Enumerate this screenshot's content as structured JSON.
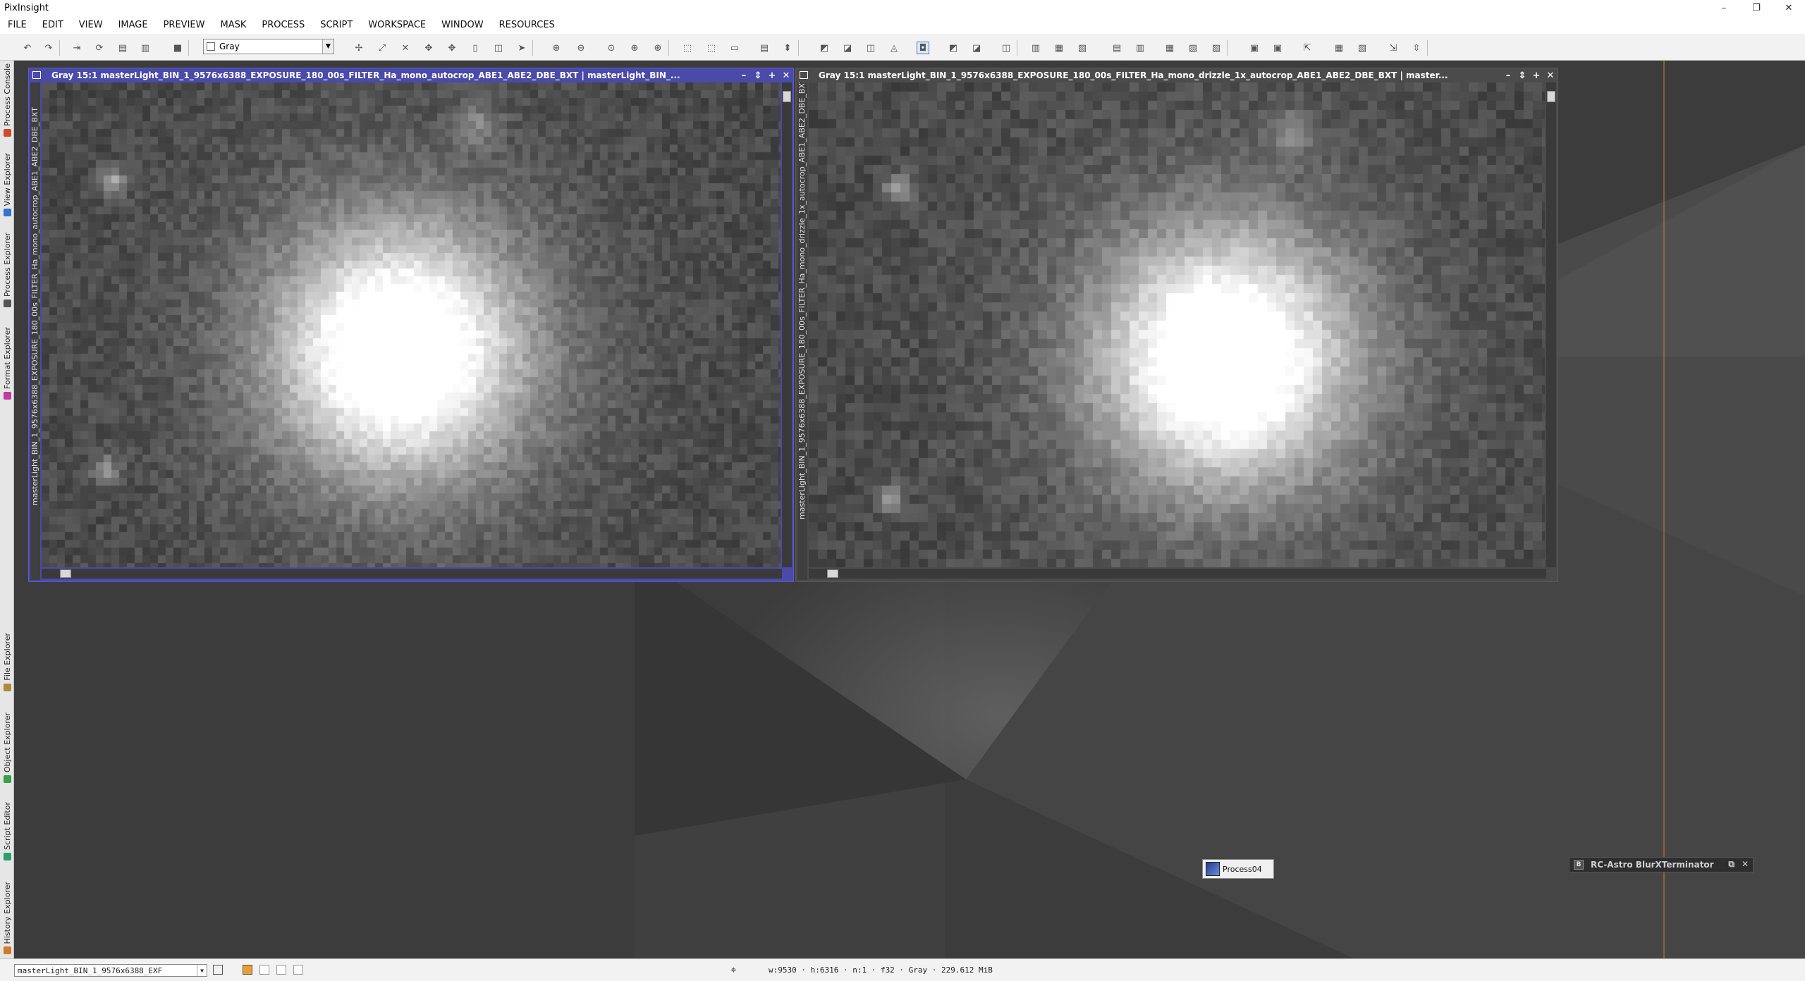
{
  "app": {
    "title": "PixInsight"
  },
  "title_controls": {
    "minimize": "–",
    "restore": "❐",
    "close": "✕"
  },
  "menu": [
    "FILE",
    "EDIT",
    "VIEW",
    "IMAGE",
    "PREVIEW",
    "MASK",
    "PROCESS",
    "SCRIPT",
    "WORKSPACE",
    "WINDOW",
    "RESOURCES"
  ],
  "toolbar": {
    "colorspace_value": "Gray"
  },
  "side_tabs": {
    "top": [
      {
        "label": "Process Console",
        "icon_color": "#d04a2a"
      },
      {
        "label": "View Explorer",
        "icon_color": "#2f74d0"
      },
      {
        "label": "Process Explorer",
        "icon_color": "#555555"
      },
      {
        "label": "Format Explorer",
        "icon_color": "#c03aa0"
      }
    ],
    "bottom": [
      {
        "label": "File Explorer",
        "icon_color": "#b08a3a"
      },
      {
        "label": "Object Explorer",
        "icon_color": "#3aa04a"
      },
      {
        "label": "Script Editor",
        "icon_color": "#2aa070"
      },
      {
        "label": "History Explorer",
        "icon_color": "#d07a2a"
      }
    ]
  },
  "windows": [
    {
      "title": "Gray 15:1 masterLight_BIN_1_9576x6388_EXPOSURE_180_00s_FILTER_Ha_mono_autocrop_ABE1_ABE2_DBE_BXT | masterLight_BIN_...",
      "side_label": "masterLight_BIN_1_9576x6388_EXPOSURE_180_00s_FILTER_Ha_mono_autocrop_ABE1_ABE2_DBE_BXT",
      "frame_color": "#4a4aa8",
      "active": true
    },
    {
      "title": "Gray 15:1 masterLight_BIN_1_9576x6388_EXPOSURE_180_00s_FILTER_Ha_mono_drizzle_1x_autocrop_ABE1_ABE2_DBE_BXT | master...",
      "side_label": "masterLight_BIN_1_9576x6388_EXPOSURE_180_00s_FILTER_Ha_mono_drizzle_1x_autocrop_ABE1_ABE2_DBE_BXT",
      "frame_color": "#4b4b4b",
      "active": false
    }
  ],
  "window_buttons": {
    "minimize": "–",
    "shade": "⇕",
    "maximize": "+",
    "close": "✕"
  },
  "process_icon": {
    "label": "Process04"
  },
  "collapsed_process": {
    "badge": "B",
    "label": "RC-Astro BlurXTerminator",
    "float": "⧉",
    "close": "✕"
  },
  "statusbar": {
    "view_select": "masterLight_BIN_1_9576x6388_EXF",
    "image_info": "w:9530 · h:6316 · n:1 · f32 · Gray · 229.612 MiB"
  }
}
